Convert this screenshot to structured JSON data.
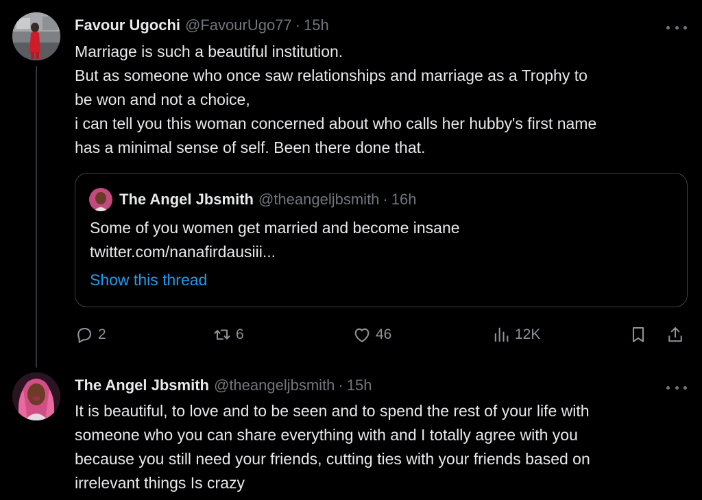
{
  "tweets": [
    {
      "name": "Favour Ugochi",
      "handle": "@FavourUgo77",
      "separator": "·",
      "time": "15h",
      "text_lines": [
        "Marriage is such a beautiful institution.",
        "But as someone who once saw relationships and marriage as a Trophy to",
        "be won and not a choice,",
        "i can tell you this woman concerned about who calls her hubby's first name",
        "has a minimal sense of self. Been there done that."
      ],
      "quote": {
        "name": "The Angel Jbsmith",
        "handle": "@theangeljbsmith",
        "separator": "·",
        "time": "16h",
        "text_lines": [
          "Some of you women get married and become insane",
          "twitter.com/nanafirdausiii..."
        ],
        "show_thread": "Show this thread"
      },
      "actions": {
        "replies": "2",
        "retweets": "6",
        "likes": "46",
        "views": "12K"
      }
    },
    {
      "name": "The Angel Jbsmith",
      "handle": "@theangeljbsmith",
      "separator": "·",
      "time": "15h",
      "text_lines": [
        "It is beautiful, to love and to be seen and to spend the rest of your life with",
        "someone who you can share everything with and I totally agree with you",
        "because you still need your friends, cutting ties with your friends based on",
        "irrelevant things Is crazy"
      ]
    }
  ],
  "icons": {
    "reply": "reply-icon",
    "retweet": "retweet-icon",
    "like": "heart-icon",
    "views": "views-icon",
    "bookmark": "bookmark-icon",
    "share": "share-icon",
    "more": "more-options-icon"
  },
  "colors": {
    "background": "#000000",
    "text": "#e7e9ea",
    "muted": "#71767b",
    "link": "#1d9bf0",
    "border": "#3e4144"
  }
}
